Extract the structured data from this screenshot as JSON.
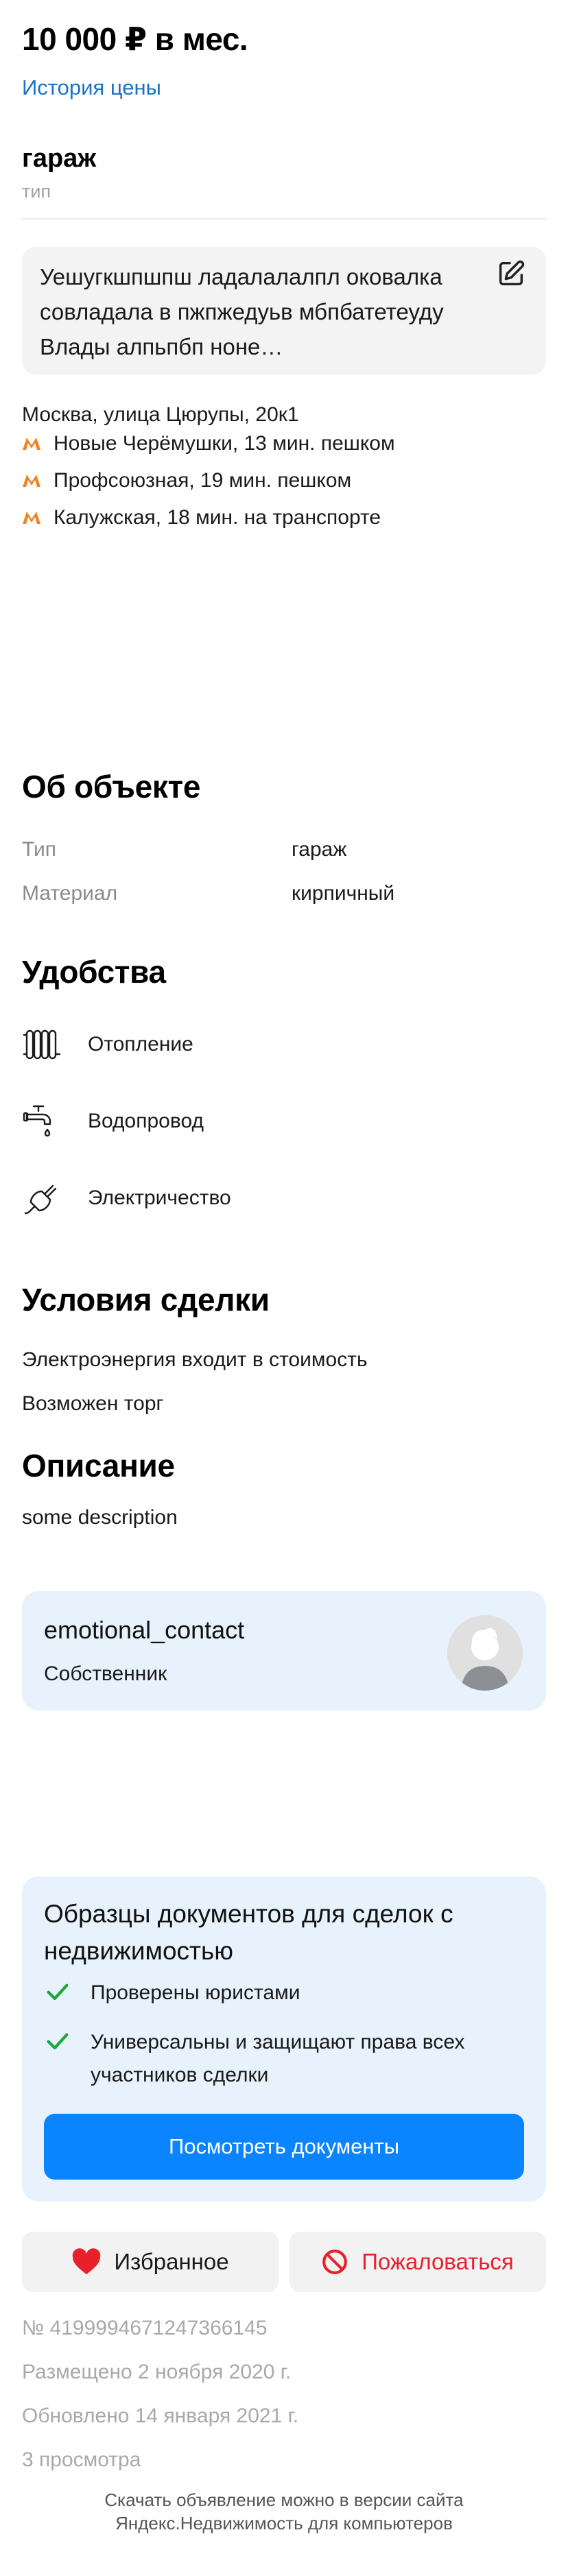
{
  "header": {
    "price": "10 000 ₽ в мес.",
    "price_history_link": "История цены"
  },
  "object_type": {
    "title": "гараж",
    "subtitle": "тип"
  },
  "note": {
    "text": "Уешугкшпшпш ладалалалпл оковалка совладала в пжпжедуьв мбпбатетеуду Влады алпьпбп ноне…",
    "edit_icon": "edit-pencil-icon"
  },
  "location": {
    "address": "Москва, улица Цюрупы, 20к1",
    "metro_icon_color": "#f58220",
    "metro": [
      {
        "text": "Новые Черёмушки, 13 мин. пешком"
      },
      {
        "text": "Профсоюзная, 19 мин. пешком"
      },
      {
        "text": "Калужская, 18 мин. на транспорте"
      }
    ]
  },
  "about": {
    "heading": "Об объекте",
    "rows": [
      {
        "key": "Тип",
        "value": "гараж"
      },
      {
        "key": "Материал",
        "value": "кирпичный"
      }
    ]
  },
  "amenities": {
    "heading": "Удобства",
    "items": [
      {
        "label": "Отопление",
        "icon": "radiator-icon"
      },
      {
        "label": "Водопровод",
        "icon": "water-tap-icon"
      },
      {
        "label": "Электричество",
        "icon": "electric-plug-icon"
      }
    ]
  },
  "deal": {
    "heading": "Условия сделки",
    "items": [
      "Электроэнергия входит в стоимость",
      "Возможен торг"
    ]
  },
  "description": {
    "heading": "Описание",
    "text": "some description"
  },
  "owner": {
    "name": "emotional_contact",
    "role": "Собственник",
    "avatar_icon": "user-avatar-placeholder"
  },
  "documents": {
    "title": "Образцы документов для сделок с недвижимостью",
    "check_color": "#1fa83a",
    "points": [
      "Проверены юристами",
      "Универсальны и защищают права всех участников сделки"
    ],
    "button": "Посмотреть документы",
    "button_color": "#0a84ff"
  },
  "actions": {
    "favorite": "Избранное",
    "favorite_color": "#e8202a",
    "report": "Пожаловаться",
    "report_color": "#e8202a"
  },
  "meta": {
    "id": "№ 4199994671247366145",
    "published": "Размещено 2 ноября 2020 г.",
    "updated": "Обновлено 14 января 2021 г.",
    "views": "3 просмотра"
  },
  "footer": {
    "line1": "Скачать объявление можно в версии сайта",
    "line2": "Яндекс.Недвижимость для компьютеров"
  }
}
